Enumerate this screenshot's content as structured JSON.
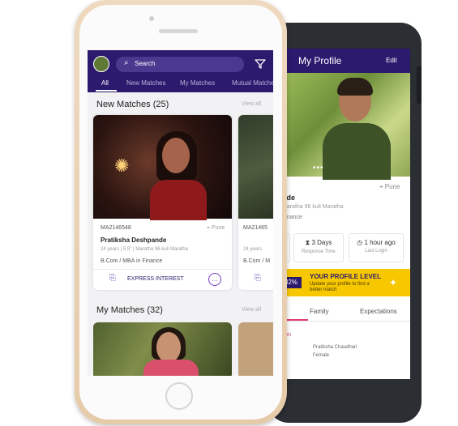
{
  "app": {
    "header": {
      "search_placeholder": "Search",
      "tabs": [
        {
          "label": "All",
          "active": true
        },
        {
          "label": "New Matches",
          "active": false
        },
        {
          "label": "My Matches",
          "active": false
        },
        {
          "label": "Mutual Matches",
          "active": false
        }
      ]
    },
    "new_matches": {
      "title": "New Matches (25)",
      "view_all": "View all",
      "cards": [
        {
          "id": "MA2146548",
          "location": "Pune",
          "name": "Pratiksha Deshpande",
          "details": "24 years  |  5.5\"  |  Maratha 96 kuli Maratha",
          "education": "B.Com / MBA in Finance",
          "action": "EXPRESS INTEREST"
        },
        {
          "id": "MA21465",
          "details": "24 years",
          "education": "B.Com / M"
        }
      ]
    },
    "my_matches": {
      "title": "My Matches (32)",
      "view_all": "View all"
    }
  },
  "profile": {
    "title": "My Profile",
    "edit": "Edit",
    "location": "Pune",
    "name_partial": "nde",
    "community_partial": "Maratha 96 kuli Maratha",
    "profession_partial": "Finance",
    "stats": [
      {
        "value": "3 Days",
        "label": "Response Time"
      },
      {
        "value": "1 hour ago",
        "label": "Last Login"
      }
    ],
    "profile_level": {
      "percent": "32%",
      "title": "YOUR PROFILE LEVEL",
      "subtitle": "Update your profile to find a better match"
    },
    "tabs": [
      {
        "label": "Family"
      },
      {
        "label": "Expectations"
      }
    ],
    "section_partial": "nation",
    "detail_lines": [
      "Pratiksha Chaudhari",
      "Female"
    ]
  },
  "colors": {
    "brand_purple": "#2b1a6e",
    "accent_yellow": "#f7c800",
    "accent_pink": "#e23c77"
  },
  "icons": [
    "search-icon",
    "filter-icon",
    "location-pin-icon",
    "express-interest-icon",
    "chat-icon",
    "hourglass-icon",
    "clock-icon",
    "sparkle-icon"
  ]
}
